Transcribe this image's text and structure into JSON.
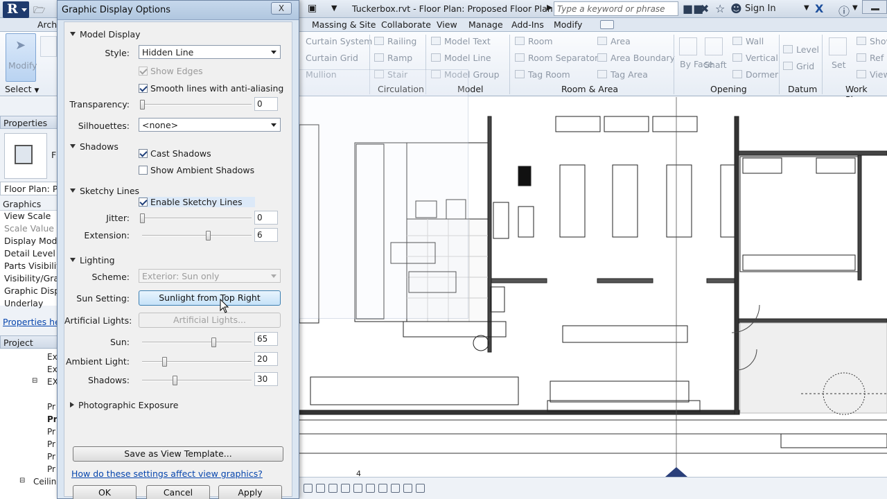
{
  "titlebar": {
    "document_title": "Tuckerbox.rvt - Floor Plan: Proposed Floor Plan Co...",
    "search_placeholder": "Type a keyword or phrase",
    "sign_in": "Sign In"
  },
  "ribbon": {
    "tabs": [
      "Arch",
      "Massing & Site",
      "Collaborate",
      "View",
      "Manage",
      "Add-Ins",
      "Modify"
    ],
    "modify_button": "Modify",
    "select_dropdown": "Select",
    "circulation": [
      "Curtain System",
      "Curtain Grid",
      "Mullion",
      "Railing",
      "Ramp",
      "Stair"
    ],
    "model": [
      "Model Text",
      "Model Line",
      "Model Group"
    ],
    "room_area": [
      "Room",
      "Room Separator",
      "Tag Room",
      "Area",
      "Area Boundary",
      "Tag Area"
    ],
    "opening": [
      "By Face",
      "Shaft",
      "Wall",
      "Vertical",
      "Dormer"
    ],
    "datum": [
      "Level",
      "Grid"
    ],
    "work_plane": [
      "Set",
      "Show",
      "Ref",
      "View"
    ],
    "group_labels": [
      "Circulation",
      "Model",
      "Room & Area",
      "Opening",
      "Datum",
      "Work Plane"
    ]
  },
  "properties": {
    "header": "Properties",
    "type_selector": "Floor Plan: Pro",
    "section": "Graphics",
    "rows": [
      "View Scale",
      "Scale Value",
      "Display Mode",
      "Detail Level",
      "Parts Visibility",
      "Visibility/Grap",
      "Graphic Displ",
      "Underlay"
    ],
    "help_link": "Properties help"
  },
  "project_browser": {
    "header": "Project Browse",
    "rows": [
      "Ex",
      "Ex",
      "EX",
      "Pr",
      "Pr",
      "Pr",
      "Pr",
      "Pr",
      "Pr",
      "Ceiling"
    ]
  },
  "dialog": {
    "title": "Graphic Display Options",
    "close": "X",
    "model_display": {
      "header": "Model Display",
      "style_label": "Style:",
      "style_value": "Hidden Line",
      "show_edges": "Show Edges",
      "smooth_lines": "Smooth lines with anti-aliasing",
      "transparency_label": "Transparency:",
      "transparency_value": "0",
      "transparency_level": 0,
      "silhouettes_label": "Silhouettes:",
      "silhouettes_value": "<none>"
    },
    "shadows": {
      "header": "Shadows",
      "cast_shadows": "Cast Shadows",
      "ambient_shadows": "Show Ambient Shadows"
    },
    "sketchy_lines": {
      "header": "Sketchy Lines",
      "enable": "Enable Sketchy Lines",
      "jitter_label": "Jitter:",
      "jitter_value": "0",
      "jitter_level": 0,
      "extension_label": "Extension:",
      "extension_value": "6",
      "extension_level": 0.6
    },
    "lighting": {
      "header": "Lighting",
      "scheme_label": "Scheme:",
      "scheme_value": "Exterior: Sun only",
      "sun_setting_label": "Sun Setting:",
      "sun_setting_value": "Sunlight from Top Right",
      "artificial_label": "Artificial Lights:",
      "artificial_button": "Artificial Lights...",
      "sun_label": "Sun:",
      "sun_value": "65",
      "sun_level": 0.65,
      "ambient_label": "Ambient Light:",
      "ambient_value": "20",
      "ambient_level": 0.2,
      "shadows_label": "Shadows:",
      "shadows_value": "30",
      "shadows_level": 0.3
    },
    "photographic_exposure": "Photographic Exposure",
    "save_template": "Save as View Template...",
    "help_link": "How do these settings affect view graphics?",
    "ok": "OK",
    "cancel": "Cancel",
    "apply": "Apply"
  },
  "statusbar": {
    "number": "4"
  }
}
